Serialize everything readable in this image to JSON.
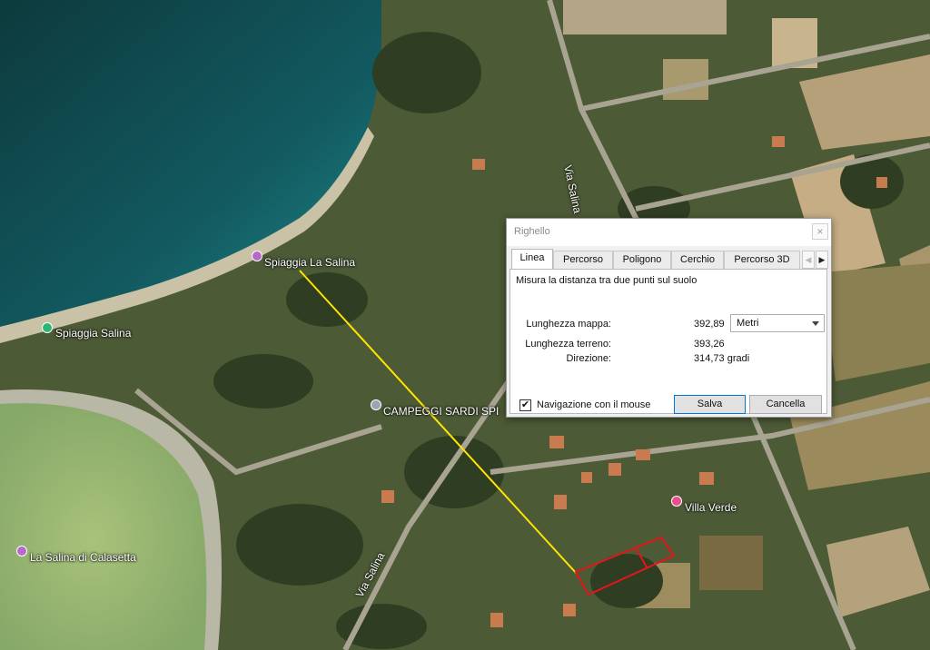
{
  "map": {
    "place_labels": [
      {
        "name": "Spiaggia La Salina",
        "icon": "beach-pin-icon",
        "color": "#b569c9"
      },
      {
        "name": "Spiaggia Salina",
        "icon": "beach-pin-icon",
        "color": "#2bb673"
      },
      {
        "name": "La Salina di Calasetta",
        "icon": "place-pin-icon",
        "color": "#b569c9"
      },
      {
        "name": "CAMPEGGI SARDI SPI",
        "icon": "camping-pin-icon",
        "color": "#9aa4b4"
      },
      {
        "name": "Villa Verde",
        "icon": "lodging-pin-icon",
        "color": "#e94d8f"
      }
    ],
    "road_labels": [
      "Via Salina",
      "Via Salina"
    ],
    "measure_line_color": "#ffe600",
    "parcel_outline_color": "#e8141b"
  },
  "dialog": {
    "title": "Righello",
    "close_glyph": "×",
    "tabs": [
      "Linea",
      "Percorso",
      "Poligono",
      "Cerchio",
      "Percorso 3D"
    ],
    "active_tab": "Linea",
    "description": "Misura la distanza tra due punti sul suolo",
    "map_length": {
      "label": "Lunghezza mappa:",
      "value": "392,89"
    },
    "unit_select": {
      "value": "Metri"
    },
    "ground_length": {
      "label": "Lunghezza terreno:",
      "value": "393,26"
    },
    "heading": {
      "label": "Direzione:",
      "value": "314,73 gradi"
    },
    "mouse_nav": {
      "label": "Navigazione con il mouse",
      "checked": true,
      "check_glyph": "✔"
    },
    "save_label": "Salva",
    "cancel_label": "Cancella",
    "accent_color": "#0078d7"
  }
}
